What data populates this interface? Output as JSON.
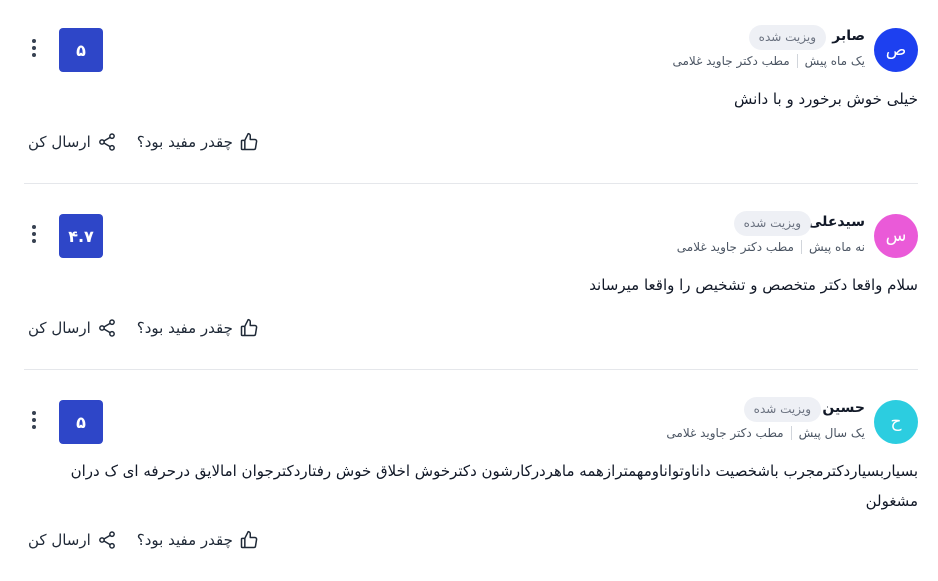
{
  "reviews": [
    {
      "name": "صابر",
      "initial": "ص",
      "avatar_color": "#1d40f0",
      "badge": "ویزیت شده",
      "time": "یک ماه پیش",
      "clinic": "مطب دکتر جاوید غلامی",
      "score": "۵",
      "comment": "خیلی خوش برخورد و با دانش",
      "helpful_label": "چقدر مفید بود؟",
      "share_label": "ارسال کن"
    },
    {
      "name": "سیدعلی",
      "initial": "س",
      "avatar_color": "#ea5ad8",
      "badge": "ویزیت شده",
      "time": "نه ماه پیش",
      "clinic": "مطب دکتر جاوید غلامی",
      "score": "۴.۷",
      "comment": "سلام واقعا دکتر متخصص و تشخیص را واقعا میرساند",
      "helpful_label": "چقدر مفید بود؟",
      "share_label": "ارسال کن"
    },
    {
      "name": "حسین",
      "initial": "ح",
      "avatar_color": "#2ccde0",
      "badge": "ویزیت شده",
      "time": "یک سال پیش",
      "clinic": "مطب دکتر جاوید غلامی",
      "score": "۵",
      "comment": "بسیاربسیاردکترمجرب باشخصیت داناوتواناومهمترازهمه ماهردرکارشون دکترخوش اخلاق خوش رفتاردکترجوان امالایق درحرفه ای ک دران مشغولن",
      "helpful_label": "چقدر مفید بود؟",
      "share_label": "ارسال کن"
    }
  ]
}
